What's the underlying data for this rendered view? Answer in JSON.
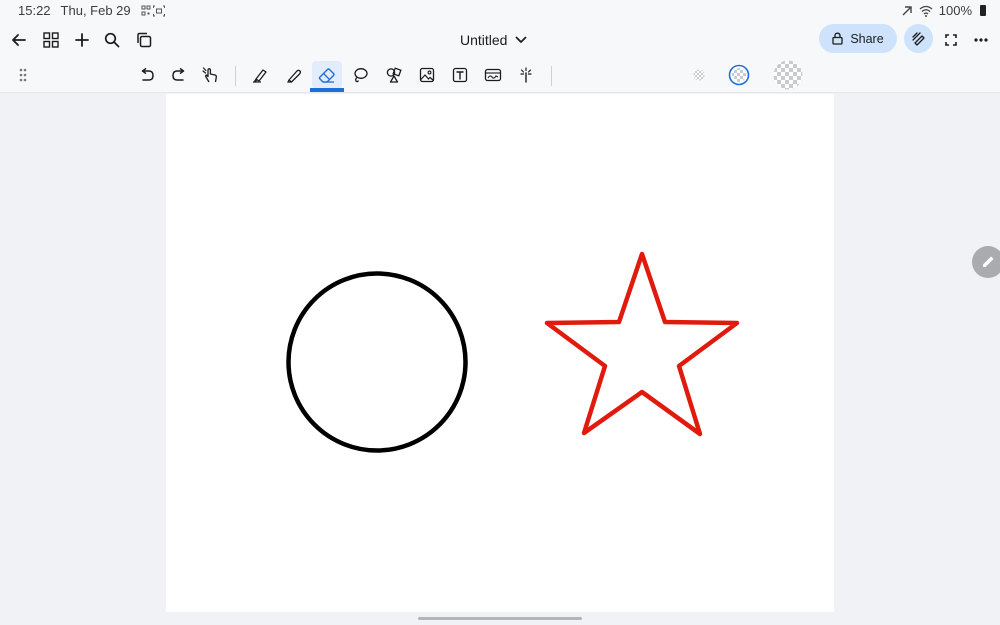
{
  "status": {
    "time": "15:22",
    "date": "Thu, Feb 29",
    "battery": "100%"
  },
  "topbar": {
    "title": "Untitled",
    "share_label": "Share"
  },
  "canvas": {
    "shapes": [
      {
        "kind": "circle",
        "stroke": "#000000"
      },
      {
        "kind": "star",
        "stroke": "#e01b0e"
      }
    ]
  },
  "colors": {
    "accent": "#1e6fd9",
    "share_bg": "#cfe2fb",
    "star_red": "#e01b0e"
  },
  "icons": {
    "back": "arrow-left-icon",
    "grid": "grid-icon",
    "add": "plus-icon",
    "search": "search-icon",
    "pages": "copy-icon",
    "dropdown": "chevron-down-icon",
    "lock": "lock-icon",
    "fullscreen": "fullscreen-icon",
    "more": "more-icon"
  }
}
